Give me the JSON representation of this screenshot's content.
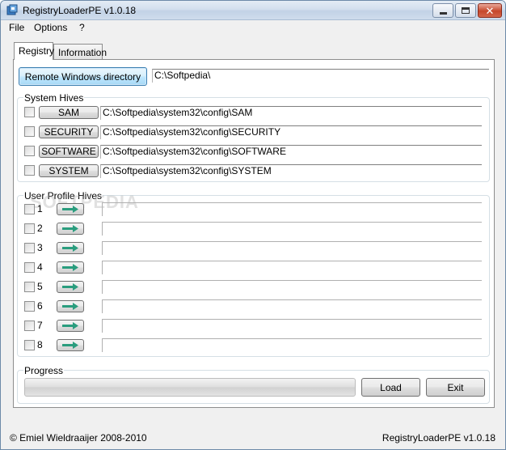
{
  "window": {
    "title": "RegistryLoaderPE v1.0.18",
    "close_glyph": "✕"
  },
  "menu": [
    "File",
    "Options",
    "?"
  ],
  "tabs": [
    {
      "label": "Registry",
      "active": true
    },
    {
      "label": "Information",
      "active": false
    }
  ],
  "remote": {
    "button_label": "Remote Windows directory",
    "path": "C:\\Softpedia\\"
  },
  "system_hives": {
    "title": "System Hives",
    "items": [
      {
        "label": "SAM",
        "path": "C:\\Softpedia\\system32\\config\\SAM"
      },
      {
        "label": "SECURITY",
        "path": "C:\\Softpedia\\system32\\config\\SECURITY"
      },
      {
        "label": "SOFTWARE",
        "path": "C:\\Softpedia\\system32\\config\\SOFTWARE"
      },
      {
        "label": "SYSTEM",
        "path": "C:\\Softpedia\\system32\\config\\SYSTEM"
      }
    ]
  },
  "user_hives": {
    "title": "User Profile Hives",
    "items": [
      "1",
      "2",
      "3",
      "4",
      "5",
      "6",
      "7",
      "8"
    ],
    "arrow_icon": "right-arrow-icon"
  },
  "progress": {
    "title": "Progress",
    "value": 0,
    "fill_color": "#37b34a"
  },
  "buttons": {
    "load": "Load",
    "exit": "Exit"
  },
  "status": {
    "copyright": "© Emiel Wieldraaijer 2008-2010",
    "version": "RegistryLoaderPE v1.0.18"
  },
  "watermark": "SOFTPEDIA",
  "colors": {
    "title_bar": "#d3dfee",
    "arrow": "#2a9d7e",
    "close_button": "#c6472b"
  }
}
